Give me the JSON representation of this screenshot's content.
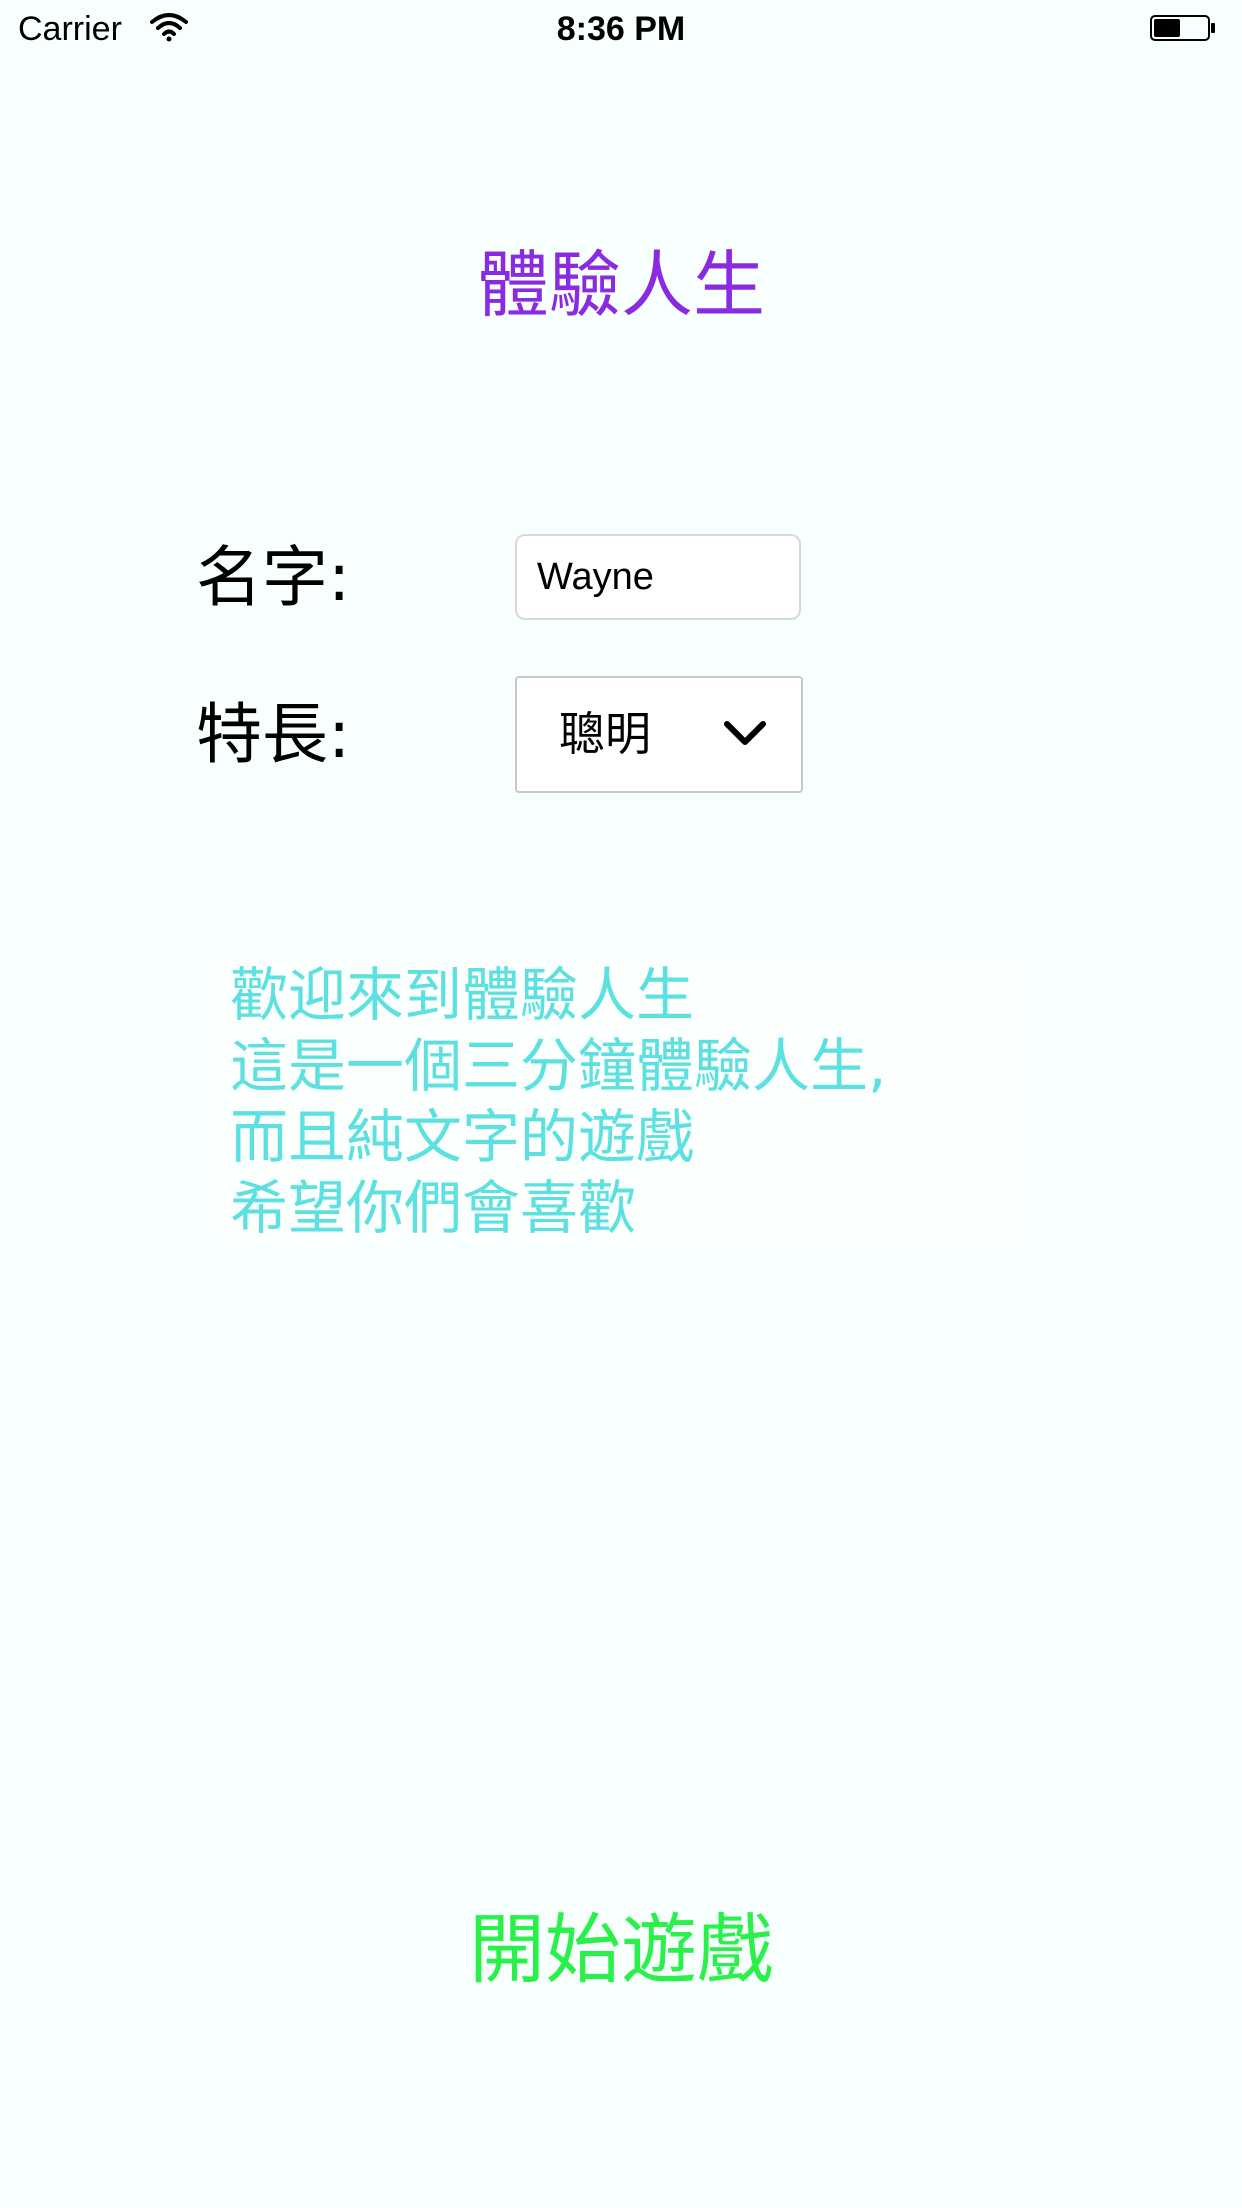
{
  "status_bar": {
    "carrier": "Carrier",
    "time": "8:36 PM",
    "battery_level": 0.5
  },
  "title": "體驗人生",
  "form": {
    "name_label": "名字:",
    "name_value": "Wayne",
    "skill_label": "特長:",
    "skill_value": "聰明"
  },
  "intro": {
    "lines": [
      "歡迎來到體驗人生",
      "這是一個三分鐘體驗人生,",
      "而且純文字的遊戲",
      "希望你們會喜歡"
    ]
  },
  "start_button_label": "開始遊戲",
  "colors": {
    "background": "#f8ffff",
    "title": "#8a2be2",
    "intro_text": "#5de0e0",
    "start_button": "#2af04a"
  },
  "icons": {
    "wifi": "wifi-icon",
    "battery": "battery-icon",
    "dropdown": "chevron-down-icon"
  }
}
